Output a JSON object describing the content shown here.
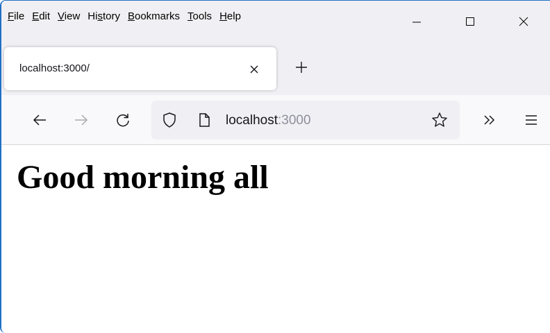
{
  "menu": [
    {
      "mnemonic": "F",
      "rest": "ile"
    },
    {
      "mnemonic": "E",
      "rest": "dit"
    },
    {
      "mnemonic": "V",
      "rest": "iew"
    },
    {
      "pre": "Hi",
      "mnemonic": "s",
      "rest": "tory"
    },
    {
      "mnemonic": "B",
      "rest": "ookmarks"
    },
    {
      "mnemonic": "T",
      "rest": "ools"
    },
    {
      "mnemonic": "H",
      "rest": "elp"
    }
  ],
  "window_controls": {
    "minimize_icon": "minimize-icon",
    "maximize_icon": "maximize-icon",
    "close_icon": "close-icon"
  },
  "tab": {
    "title": "localhost:3000/",
    "close_icon": "close-icon",
    "new_tab_icon": "plus-icon"
  },
  "navbar": {
    "back_icon": "arrow-left-icon",
    "forward_icon": "arrow-right-icon",
    "reload_icon": "reload-icon",
    "shield_icon": "shield-icon",
    "page_icon": "page-icon",
    "url_host": "localhost",
    "url_port": ":3000",
    "bookmark_icon": "star-icon",
    "overflow_icon": "chevron-double-right-icon",
    "menu_icon": "hamburger-icon"
  },
  "page": {
    "heading": "Good morning all"
  },
  "colors": {
    "chrome_bg": "#f0f0f4",
    "navbar_bg": "#f9f9fb",
    "window_border": "#1f6fc5",
    "port_text": "#8f8f9d"
  }
}
